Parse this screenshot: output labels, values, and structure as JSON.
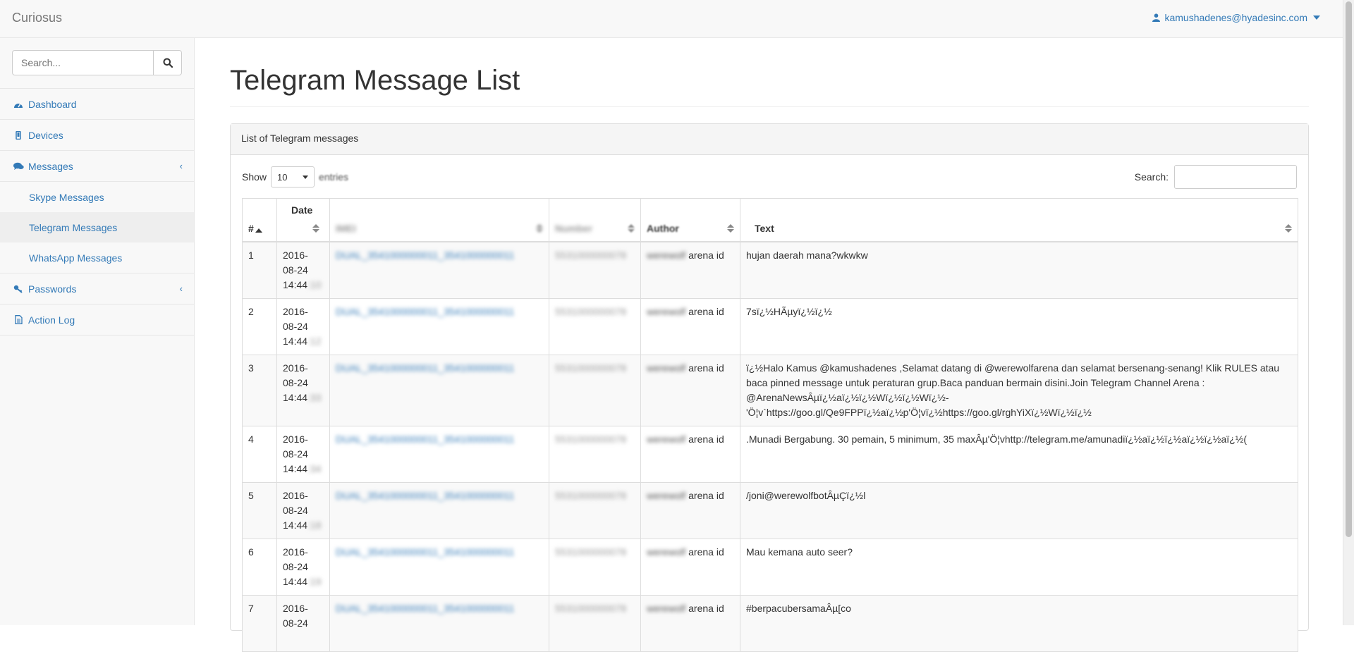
{
  "navbar": {
    "brand": "Curiosus",
    "user_email": "kamushadenes@hyadesinc.com"
  },
  "sidebar": {
    "search_placeholder": "Search...",
    "items": [
      {
        "label": "Dashboard",
        "icon": "dashboard-icon"
      },
      {
        "label": "Devices",
        "icon": "mobile-icon"
      },
      {
        "label": "Messages",
        "icon": "comments-icon",
        "expanded": true
      },
      {
        "label": "Passwords",
        "icon": "key-icon"
      },
      {
        "label": "Action Log",
        "icon": "file-icon"
      }
    ],
    "messages_sub": [
      {
        "label": "Skype Messages",
        "active": false
      },
      {
        "label": "Telegram Messages",
        "active": true
      },
      {
        "label": "WhatsApp Messages",
        "active": false
      }
    ]
  },
  "main": {
    "page_title": "Telegram Message List",
    "panel_heading": "List of Telegram messages",
    "show_label": "Show",
    "entries_value": "10",
    "entries_label": "entries",
    "search_label": "Search:",
    "search_value": ""
  },
  "table": {
    "headers": {
      "num": "#",
      "date": "Date",
      "imei": "IMEI",
      "number": "Number",
      "author": "Author",
      "text": "Text"
    },
    "rows": [
      {
        "num": "1",
        "date_l1": "2016-",
        "date_l2": "08-24",
        "date_time": "14:44",
        "date_sec": ":10",
        "imei": "DUAL_3541000000011_3541000000011",
        "number": "5531000000078",
        "author_blur": "werewolf",
        "author": " arena id",
        "text": "hujan daerah mana?wkwkw"
      },
      {
        "num": "2",
        "date_l1": "2016-",
        "date_l2": "08-24",
        "date_time": "14:44",
        "date_sec": ":12",
        "imei": "DUAL_3541000000011_3541000000011",
        "number": "5531000000078",
        "author_blur": "werewolf",
        "author": " arena id",
        "text": "7sï¿½HÃµyï¿½ï¿½"
      },
      {
        "num": "3",
        "date_l1": "2016-",
        "date_l2": "08-24",
        "date_time": "14:44",
        "date_sec": ":33",
        "imei": "DUAL_3541000000011_3541000000011",
        "number": "5531000000078",
        "author_blur": "werewolf",
        "author": " arena id",
        "text": "ï¿½Halo Kamus @kamushadenes ,Selamat datang di @werewolfarena dan selamat bersenang-senang! Klik RULES atau baca pinned message untuk peraturan grup.Baca panduan bermain disini.Join Telegram Channel Arena : @ArenaNewsÂµï¿½aï¿½ï¿½Wï¿½ï¿½Wï¿½-'Ö¦v`https://goo.gl/Qe9FPPï¿½aï¿½p'Ö¦vï¿½https://goo.gl/rghYiXï¿½Wï¿½ï¿½"
      },
      {
        "num": "4",
        "date_l1": "2016-",
        "date_l2": "08-24",
        "date_time": "14:44",
        "date_sec": ":34",
        "imei": "DUAL_3541000000011_3541000000011",
        "number": "5531000000078",
        "author_blur": "werewolf",
        "author": " arena id",
        "text": ".Munadi Bergabung. 30 pemain, 5 minimum, 35 maxÂµ'Ö¦vhttp://telegram.me/amunadiï¿½aï¿½ï¿½aï¿½ï¿½aï¿½("
      },
      {
        "num": "5",
        "date_l1": "2016-",
        "date_l2": "08-24",
        "date_time": "14:44",
        "date_sec": ":18",
        "imei": "DUAL_3541000000011_3541000000011",
        "number": "5531000000078",
        "author_blur": "werewolf",
        "author": " arena id",
        "text": "/joni@werewolfbotÂµÇï¿½l"
      },
      {
        "num": "6",
        "date_l1": "2016-",
        "date_l2": "08-24",
        "date_time": "14:44",
        "date_sec": ":19",
        "imei": "DUAL_3541000000011_3541000000011",
        "number": "5531000000078",
        "author_blur": "werewolf",
        "author": " arena id",
        "text": "Mau kemana auto seer?"
      },
      {
        "num": "7",
        "date_l1": "2016-",
        "date_l2": "08-24",
        "date_time": "",
        "date_sec": "",
        "imei": "DUAL_3541000000011_3541000000011",
        "number": "5531000000078",
        "author_blur": "werewolf",
        "author": " arena id",
        "text": "#berpacubersamaÂµ[co"
      }
    ]
  }
}
